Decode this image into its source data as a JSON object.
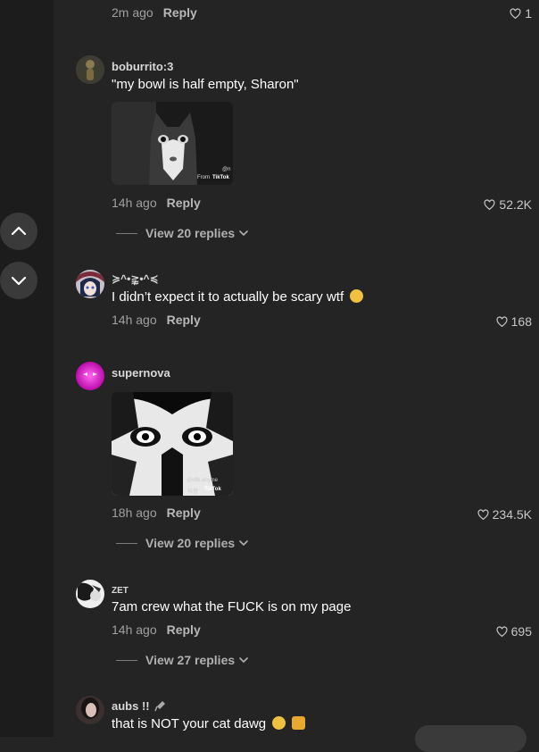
{
  "comments": [
    {
      "time": "2m ago",
      "reply": "Reply",
      "likes": "1"
    },
    {
      "username": "boburrito:3",
      "text": "\"my bowl is half empty, Sharon\"",
      "time": "14h ago",
      "reply": "Reply",
      "likes": "52.2K",
      "replies": "View 20 replies",
      "media_watermark": {
        "account": "@n",
        "brand": "TikTok",
        "from": "From"
      }
    },
    {
      "username": "≽^•⪊•^≼",
      "text": "I didn’t expect it to actually be scary wtf",
      "time": "14h ago",
      "reply": "Reply",
      "likes": "168"
    },
    {
      "username": "supernova",
      "time": "18h ago",
      "reply": "Reply",
      "likes": "234.5K",
      "replies": "View 20 replies",
      "media_watermark": {
        "account": "@idfk.anyme",
        "brand": "TikTok",
        "prefix": "抖音"
      }
    },
    {
      "username": "ZET",
      "text": "7am crew what the FUCK is on my page",
      "time": "14h ago",
      "reply": "Reply",
      "likes": "695",
      "replies": "View 27 replies"
    },
    {
      "username": "aubs !!",
      "text": "that is NOT your cat dawg"
    }
  ],
  "icons": {
    "scroll_up": "chevron-up-icon",
    "scroll_down": "chevron-down-icon",
    "like": "heart-icon",
    "expand": "chevron-down-icon",
    "badge": "microphone-icon"
  },
  "colors": {
    "background": "#242424",
    "rail": "#1c1c1c",
    "text": "#ffffff",
    "muted": "#a0a0a0"
  }
}
